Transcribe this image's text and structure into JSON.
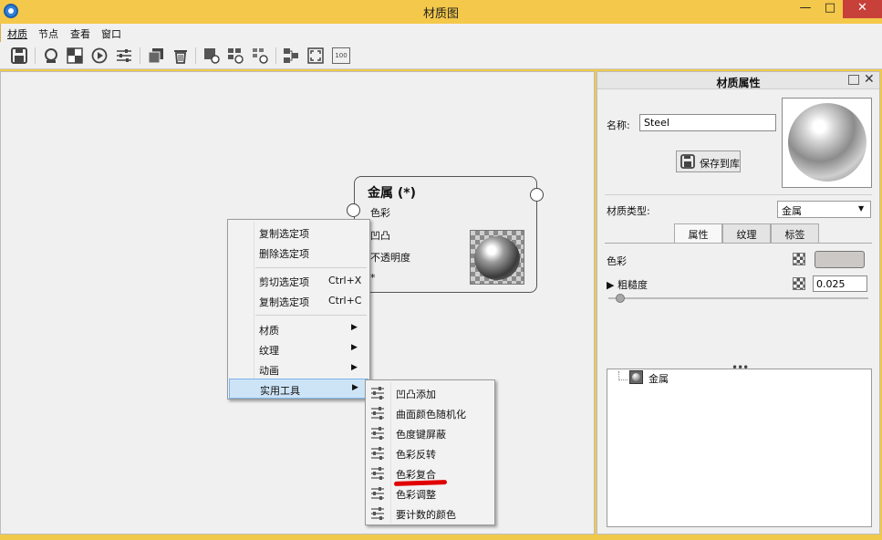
{
  "window": {
    "title": "材质图",
    "minimize_label": "—",
    "maximize_label": "□",
    "close_label": "✕"
  },
  "menubar": {
    "items": [
      "材质",
      "节点",
      "查看",
      "窗口"
    ]
  },
  "toolbar": {
    "icons": [
      "save-icon",
      "material-ball-icon",
      "checker-icon",
      "play-icon",
      "sliders-icon",
      "copy-icon",
      "trash-icon",
      "node-icon",
      "node-group-icon",
      "node-add-icon",
      "layout-icon",
      "fit-view-icon",
      "zoom-100-icon"
    ],
    "zoom_label": "100"
  },
  "node": {
    "title": "金属 (*)",
    "inputs": [
      "色彩",
      "凹凸",
      "不透明度",
      "*"
    ]
  },
  "context_menu": {
    "items": [
      {
        "label": "复制选定项",
        "shortcut": "",
        "submenu": false
      },
      {
        "label": "删除选定项",
        "shortcut": "",
        "submenu": false
      },
      {
        "label": "剪切选定项",
        "shortcut": "Ctrl+X",
        "submenu": false
      },
      {
        "label": "复制选定项",
        "shortcut": "Ctrl+C",
        "submenu": false
      },
      {
        "label": "材质",
        "shortcut": "",
        "submenu": true
      },
      {
        "label": "纹理",
        "shortcut": "",
        "submenu": true
      },
      {
        "label": "动画",
        "shortcut": "",
        "submenu": true
      },
      {
        "label": "实用工具",
        "shortcut": "",
        "submenu": true
      }
    ],
    "arrow": "▶"
  },
  "submenu": {
    "items": [
      "凹凸添加",
      "曲面颜色随机化",
      "色度键屏蔽",
      "色彩反转",
      "色彩复合",
      "色彩调整",
      "要计数的颜色"
    ]
  },
  "panel": {
    "title": "材质属性",
    "close_label": "✕",
    "name_label": "名称:",
    "name_value": "Steel",
    "save_button": "保存到库",
    "material_type_label": "材质类型:",
    "material_type_value": "金属",
    "dropdown_arrow": "▼",
    "tabs": [
      "属性",
      "纹理",
      "标签"
    ],
    "color_label": "色彩",
    "color_swatch": "#cbc8c5",
    "roughness_label": "▶ 粗糙度",
    "roughness_value": "0.025",
    "roughness_fraction": 0.025,
    "grip": "•••",
    "tree_item": "金属"
  },
  "colors": {
    "title_bar": "#f4c84a",
    "close_button": "#c7413a",
    "highlight": "#cde4f7",
    "annotation_underline": "#e00000"
  }
}
